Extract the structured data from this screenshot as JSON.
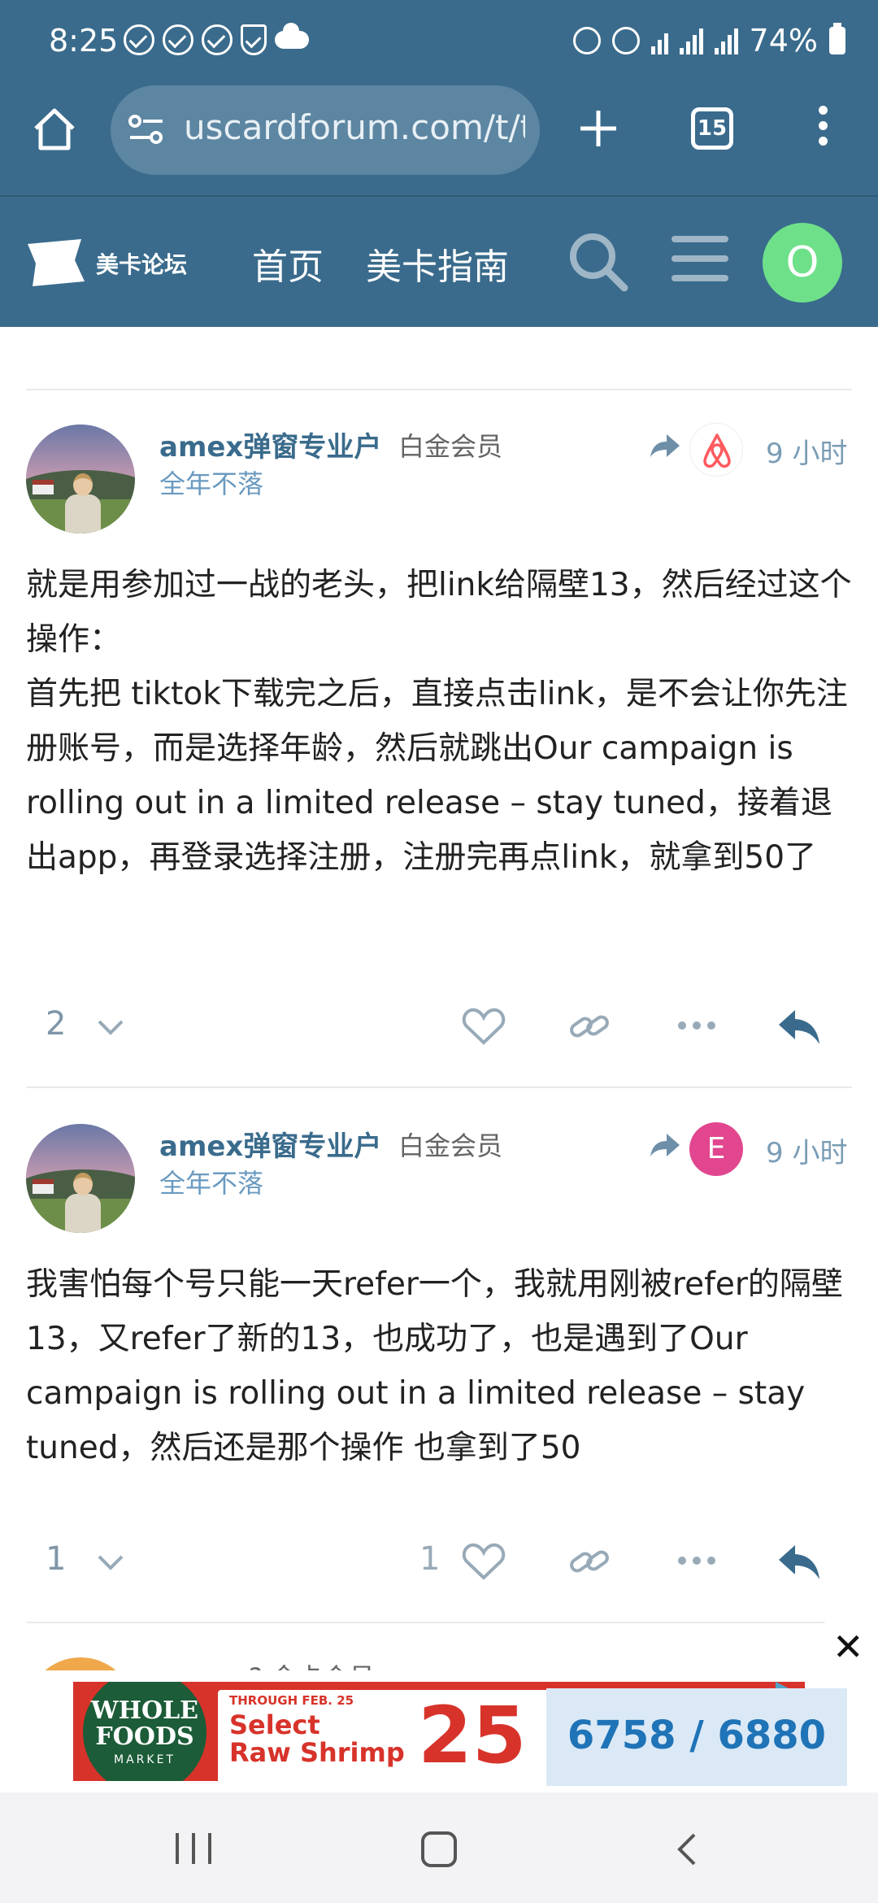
{
  "status_bar": {
    "time": "8:25",
    "battery": "74%"
  },
  "browser": {
    "url": "uscardforum.com/t/t",
    "tab_count": "15"
  },
  "forum_header": {
    "logo_text": "美卡论坛",
    "nav": [
      "首页",
      "美卡指南"
    ],
    "user_avatar_letter": "O",
    "accent_color": "#3a6b8c"
  },
  "posts": [
    {
      "username": "amex弹窗专业户",
      "user_title": "白金会员",
      "flair": "全年不落",
      "reply_to_avatar": "airbnb-logo",
      "time": "9 小时",
      "body": [
        "就是用参加过一战的老头，把link给隔壁13，然后经过这个操作：",
        "首先把 tiktok下载完之后，直接点击link，是不会让你先注册账号，而是选择年龄，然后就跳出Our campaign is rolling out in a limited release – stay tuned，接着退出app，再登录选择注册，注册完再点link，就拿到50了"
      ],
      "likes_count": "2",
      "like_num": ""
    },
    {
      "username": "amex弹窗专业户",
      "user_title": "白金会员",
      "flair": "全年不落",
      "reply_to_avatar_letter": "E",
      "time": "9 小时",
      "body": [
        "我害怕每个号只能一天refer一个，我就用刚被refer的隔壁13，又refer了新的13，也成功了，也是遇到了Our campaign is rolling out in a limited release – stay tuned，然后还是那个操作 也拿到了50"
      ],
      "likes_count": "1",
      "like_num": "1"
    }
  ],
  "next_post_peek": "? 金卡会员",
  "ad": {
    "brand_line1": "WHOLE",
    "brand_line2": "FOODS",
    "brand_line3": "MARKET",
    "small_text": "THROUGH FEB. 25",
    "headline1": "Select",
    "headline2": "Raw Shrimp",
    "percent": "25",
    "close_label": "✕"
  },
  "topic_progress": "6758 / 6880"
}
